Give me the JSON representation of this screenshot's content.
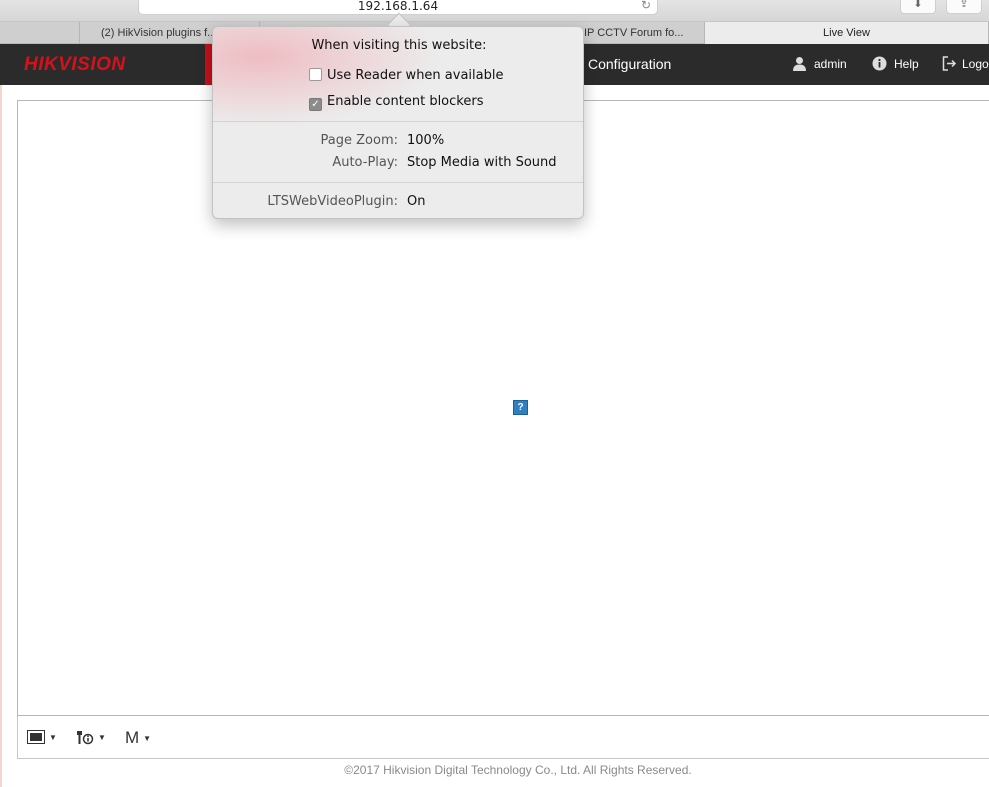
{
  "browser": {
    "url": "192.168.1.64",
    "tabs": [
      {
        "label": "(2) HikVision plugins f..."
      },
      {
        "label": "IP CCTV Forum fo..."
      },
      {
        "label": "Live View"
      }
    ]
  },
  "header": {
    "logo": "HIKVISION",
    "nav_configuration": "Configuration",
    "user": "admin",
    "help": "Help",
    "logout": "Logo"
  },
  "popover": {
    "title": "When visiting this website:",
    "use_reader": {
      "label": "Use Reader when available",
      "checked": false
    },
    "content_blockers": {
      "label": "Enable content blockers",
      "checked": true
    },
    "page_zoom_label": "Page Zoom:",
    "page_zoom_value": "100%",
    "auto_play_label": "Auto-Play:",
    "auto_play_value": "Stop Media with Sound",
    "plugin_label": "LTSWebVideoPlugin:",
    "plugin_value": "On"
  },
  "controls": {
    "m_label": "M"
  },
  "footer": "©2017 Hikvision Digital Technology Co., Ltd. All Rights Reserved.",
  "colors": {
    "brand_red": "#d7111b",
    "header_bg": "#2b2b2b"
  }
}
